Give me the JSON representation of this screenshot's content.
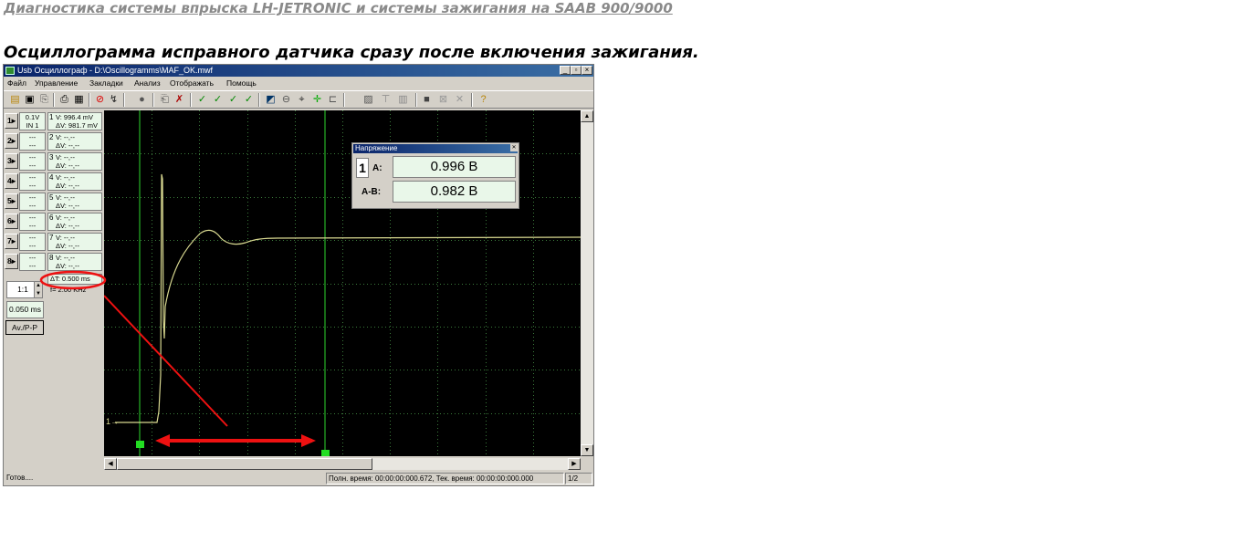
{
  "page": {
    "top_link": "Диагностика системы впрыска LH-JETRONIC и системы зажигания на SAAB 900/9000",
    "heading": "Осциллограмма исправного датчика сразу после включения зажигания."
  },
  "window": {
    "title": "Usb Осциллограф - D:\\Oscillogramms\\MAF_OK.mwf",
    "controls": [
      "_",
      "▫",
      "×"
    ]
  },
  "menu": [
    "Файл",
    "Управление",
    "Закладки",
    "Анализ",
    "Отображать",
    "Помощь"
  ],
  "channels": [
    {
      "btn": "1",
      "scale_top": "0.1V",
      "scale_bottom": "IN 1",
      "num": "1",
      "v": "V: 996.4 mV",
      "dv": "ΔV: 981.7 mV"
    },
    {
      "btn": "2",
      "scale_top": "---",
      "scale_bottom": "---",
      "num": "2",
      "v": "V: --,--",
      "dv": "ΔV: --,--"
    },
    {
      "btn": "3",
      "scale_top": "---",
      "scale_bottom": "---",
      "num": "3",
      "v": "V: --,--",
      "dv": "ΔV: --,--"
    },
    {
      "btn": "4",
      "scale_top": "---",
      "scale_bottom": "---",
      "num": "4",
      "v": "V: --,--",
      "dv": "ΔV: --,--"
    },
    {
      "btn": "5",
      "scale_top": "---",
      "scale_bottom": "---",
      "num": "5",
      "v": "V: --,--",
      "dv": "ΔV: --,--"
    },
    {
      "btn": "6",
      "scale_top": "---",
      "scale_bottom": "---",
      "num": "6",
      "v": "V: --,--",
      "dv": "ΔV: --,--"
    },
    {
      "btn": "7",
      "scale_top": "---",
      "scale_bottom": "---",
      "num": "7",
      "v": "V: --,--",
      "dv": "ΔV: --,--"
    },
    {
      "btn": "8",
      "scale_top": "---",
      "scale_bottom": "---",
      "num": "8",
      "v": "V: --,--",
      "dv": "ΔV: --,--"
    }
  ],
  "timing": {
    "dt": "ΔT: 0.500 ms",
    "freq": "f= 2.00 KHz",
    "zoom": "1:1",
    "timebase": "0.050 ms",
    "avpp": "Av./P-P"
  },
  "measure_dialog": {
    "title": "Напряжение",
    "channel": "1",
    "a_label": "A:",
    "a_value": "0.996 В",
    "ab_label": "A-B:",
    "ab_value": "0.982 В"
  },
  "plot": {
    "marker_label": "1→",
    "colors": {
      "background": "#000000",
      "grid": "#2a6a2a",
      "trace": "#d8d890",
      "cursor": "#1f8f1f",
      "annotation": "#ee1111",
      "cursor_handle": "#22dd22"
    }
  },
  "status": {
    "left": "Готов....",
    "times": "Полн. время: 00:00:00:000.672, Тек. время: 00:00:00:000.000",
    "page": "1/2"
  },
  "toolbar_icons": [
    "open-icon",
    "save-icon",
    "export-icon",
    "print-icon",
    "print-preview-icon",
    "stop-icon",
    "run-icon",
    "record-icon",
    "import-icon",
    "clear-icon",
    "check-icon",
    "check-a-icon",
    "check-b-icon",
    "check-ab-icon",
    "color-icon",
    "zoom-icon",
    "cursor-icon",
    "marker-icon",
    "bracket-icon",
    "fft-icon",
    "filter-icon",
    "delete-icon",
    "stop-square-icon",
    "grid-icon",
    "close-icon",
    "help-icon"
  ]
}
